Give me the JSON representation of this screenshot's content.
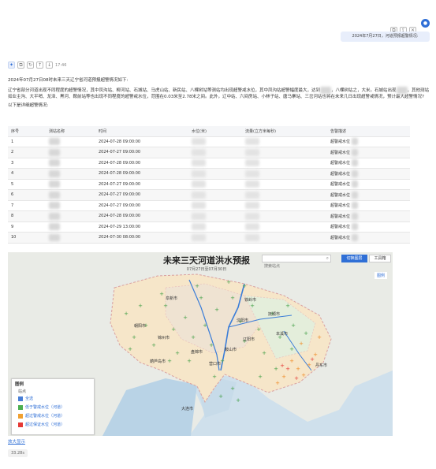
{
  "user_bubble": {
    "text": "2024年7月27日，河道预报超警情况:"
  },
  "toolbar": {
    "time": "17:46"
  },
  "answer": {
    "headline": "2024年07月27日08时未来三天辽宁省河道预报超警情况如下:",
    "para1": "辽宁省部分河道出现不同程度的超警情况，其中凤沟站、柳河站、石城站、马虎山站、新民站、八棵树站等测站均出现超警戒水位，其中凤沟站超警幅度最大，达到",
    "para2": "，八棵树站之，大米。石城站出现",
    "para3": "，其他测站如业主沟、大平哨、龙泽、黑河、鞍前站等也出现不同程度的超警戒水位，范围在0.03米至2.78米之间。此外，辽中站、六间房站、小林子站、唐马寨站、三岔河站也将在未来几日出现超警戒情况，预计最大超警情况?",
    "sub": "以下是详细超警情况:"
  },
  "table": {
    "headers": [
      "序号",
      "测站名称",
      "时间",
      "水位(米)",
      "流量(立方米每秒)",
      "告警描述"
    ],
    "rows": [
      {
        "no": "1",
        "time": "2024-07-28 09:00:00",
        "desc": "超警戒水位"
      },
      {
        "no": "2",
        "time": "2024-07-27 09:00:00",
        "desc": "超警戒水位"
      },
      {
        "no": "3",
        "time": "2024-07-28 09:00:00",
        "desc": "超警戒水位"
      },
      {
        "no": "4",
        "time": "2024-07-28 09:00:00",
        "desc": "超警戒水位"
      },
      {
        "no": "5",
        "time": "2024-07-27 09:00:00",
        "desc": "超警戒水位"
      },
      {
        "no": "6",
        "time": "2024-07-27 09:00:00",
        "desc": "超警戒水位"
      },
      {
        "no": "7",
        "time": "2024-07-27 09:00:00",
        "desc": "超警戒水位"
      },
      {
        "no": "8",
        "time": "2024-07-28 09:00:00",
        "desc": "超警戒水位"
      },
      {
        "no": "9",
        "time": "2024-07-29 13:00:00",
        "desc": "超警戒水位"
      },
      {
        "no": "10",
        "time": "2024-07-30 08:00:00",
        "desc": "超警戒水位"
      }
    ]
  },
  "map": {
    "title": "未来三天河道洪水预报",
    "subtitle": "07月27日至07月30日",
    "search_placeholder": "搜索站点",
    "btn_primary": "切换图层",
    "btn_secondary": "工具箱",
    "top_right_label": "图例",
    "cities": [
      "铁岭市",
      "抚顺市",
      "沈阳市",
      "本溪市",
      "辽阳市",
      "鞍山市",
      "营口市",
      "盘锦市",
      "锦州市",
      "阜新市",
      "朝阳市",
      "葫芦岛市",
      "大连市",
      "丹东市"
    ],
    "legend": {
      "title": "图例",
      "group": "站点",
      "items": [
        {
          "label": "全选",
          "color": "#4a7fd6"
        },
        {
          "label": "低于警戒水位（河道）",
          "color": "#4caf50"
        },
        {
          "label": "超过警戒水位（河道）",
          "color": "#f0a030"
        },
        {
          "label": "超过保证水位（河道）",
          "color": "#e53935"
        }
      ]
    }
  },
  "footer": {
    "link": "放大显示",
    "time": "33.28s"
  },
  "colors": {
    "accent": "#2f6fd6",
    "bubble": "#e8eefb"
  }
}
